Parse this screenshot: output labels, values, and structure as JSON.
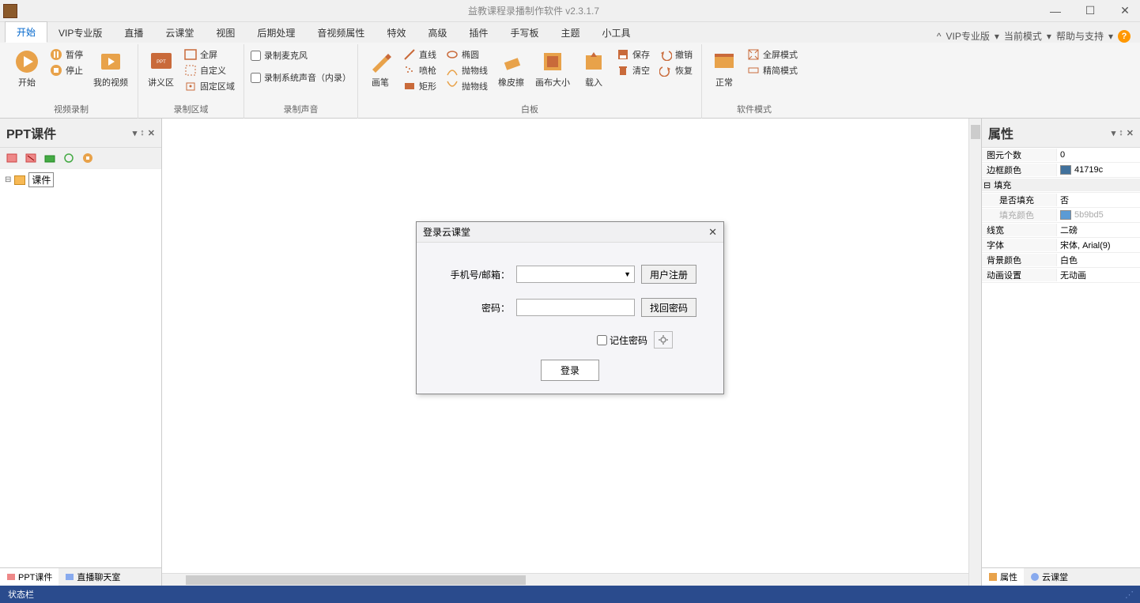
{
  "app": {
    "title": "益教课程录播制作软件 v2.3.1.7"
  },
  "menubar": {
    "tabs": [
      "开始",
      "VIP专业版",
      "直播",
      "云课堂",
      "视图",
      "后期处理",
      "音视频属性",
      "特效",
      "高级",
      "插件",
      "手写板",
      "主题",
      "小工具"
    ],
    "right": {
      "caret": "^",
      "pro": "VIP专业版",
      "mode": "当前模式",
      "help": "帮助与支持",
      "help_icon": "?"
    }
  },
  "ribbon": {
    "groups": {
      "record": {
        "label": "视频录制",
        "start": "开始",
        "pause": "暂停",
        "stop": "停止",
        "myvideo": "我的视频"
      },
      "region": {
        "label": "录制区域",
        "lecture": "讲义区",
        "full": "全屏",
        "custom": "自定义",
        "fixed": "固定区域"
      },
      "audio": {
        "label": "录制声音",
        "mic": "录制麦克风",
        "sys": "录制系统声音（内录）"
      },
      "board": {
        "label": "白板",
        "pen": "画笔",
        "line": "直线",
        "ellipse": "椭圆",
        "spray": "喷枪",
        "parabola1": "抛物线",
        "rect": "矩形",
        "parabola2": "抛物线",
        "eraser": "橡皮擦",
        "canvas_size": "画布大小",
        "load": "载入",
        "save": "保存",
        "clear": "清空",
        "undo": "撤销",
        "redo": "恢复"
      },
      "mode": {
        "label": "软件模式",
        "normal": "正常",
        "full": "全屏模式",
        "compact": "精简模式"
      }
    }
  },
  "left": {
    "title": "PPT课件",
    "tree_root": "课件",
    "tabs": {
      "ppt": "PPT课件",
      "chat": "直播聊天室"
    }
  },
  "right": {
    "title": "属性",
    "rows": {
      "count": {
        "k": "图元个数",
        "v": "0"
      },
      "border_color": {
        "k": "边框颜色",
        "v": "41719c",
        "hex": "#41719c"
      },
      "fill_cat": "填充",
      "has_fill": {
        "k": "是否填充",
        "v": "否"
      },
      "fill_color": {
        "k": "填充颜色",
        "v": "5b9bd5",
        "hex": "#5b9bd5"
      },
      "line_w": {
        "k": "线宽",
        "v": "二磅"
      },
      "font": {
        "k": "字体",
        "v": "宋体, Arial(9)"
      },
      "bg": {
        "k": "背景颜色",
        "v": "白色"
      },
      "anim": {
        "k": "动画设置",
        "v": "无动画"
      }
    },
    "tabs": {
      "props": "属性",
      "cloud": "云课堂"
    }
  },
  "dialog": {
    "title": "登录云课堂",
    "phone_label": "手机号/邮箱：",
    "pwd_label": "密码：",
    "register": "用户注册",
    "find_pwd": "找回密码",
    "remember": "记住密码",
    "login": "登录"
  },
  "status": {
    "text": "状态栏"
  }
}
